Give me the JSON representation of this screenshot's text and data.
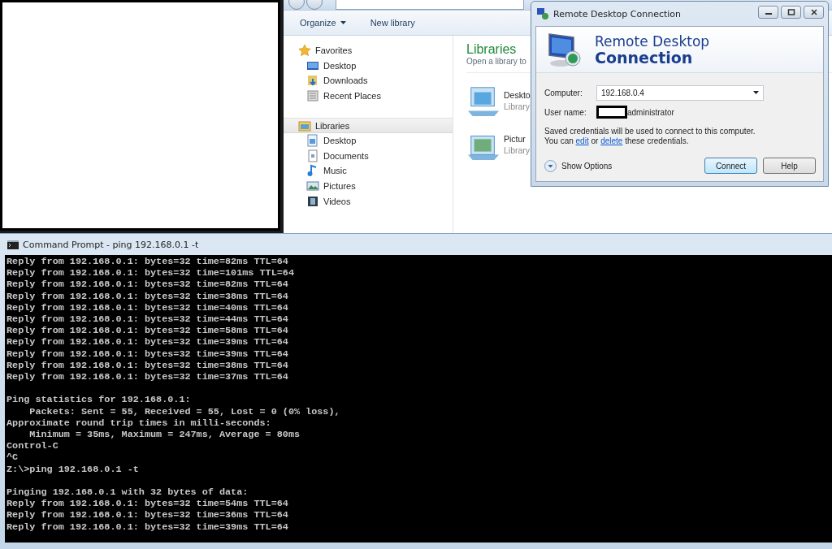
{
  "explorer": {
    "toolbar": [
      {
        "label": "Organize",
        "dropdown": true
      },
      {
        "label": "New library",
        "dropdown": false
      }
    ],
    "nav": [
      {
        "label": "Favorites",
        "selected": false,
        "children": [
          {
            "label": "Desktop"
          },
          {
            "label": "Downloads"
          },
          {
            "label": "Recent Places"
          }
        ]
      },
      {
        "label": "Libraries",
        "selected": true,
        "children": [
          {
            "label": "Desktop"
          },
          {
            "label": "Documents"
          },
          {
            "label": "Music"
          },
          {
            "label": "Pictures"
          },
          {
            "label": "Videos"
          }
        ]
      }
    ],
    "heading": "Libraries",
    "subheading": "Open a library to",
    "items": [
      {
        "name": "Deskto",
        "type": "Library"
      },
      {
        "name": "Pictur",
        "type": "Library"
      }
    ]
  },
  "rdp": {
    "title": "Remote Desktop Connection",
    "banner_top": "Remote Desktop",
    "banner_bottom": "Connection",
    "computer_label": "Computer:",
    "computer_value": "192.168.0.4",
    "username_label": "User name:",
    "username_value": "administrator",
    "note": "Saved credentials will be used to connect to this computer.",
    "note2": [
      {
        "kind": "text",
        "text": "You can "
      },
      {
        "kind": "link",
        "text": "edit"
      },
      {
        "kind": "text",
        "text": " or "
      },
      {
        "kind": "link",
        "text": "delete"
      },
      {
        "kind": "text",
        "text": " these credentials."
      }
    ],
    "options": "Show Options",
    "buttons": [
      {
        "label": "Connect",
        "default": true
      },
      {
        "label": "Help",
        "default": false
      }
    ]
  },
  "cmd": {
    "title": "Command Prompt - ping  192.168.0.1 -t",
    "blocks": [
      [
        "Reply from 192.168.0.1: bytes=32 time=82ms TTL=64",
        "Reply from 192.168.0.1: bytes=32 time=101ms TTL=64",
        "Reply from 192.168.0.1: bytes=32 time=82ms TTL=64",
        "Reply from 192.168.0.1: bytes=32 time=38ms TTL=64",
        "Reply from 192.168.0.1: bytes=32 time=40ms TTL=64",
        "Reply from 192.168.0.1: bytes=32 time=44ms TTL=64",
        "Reply from 192.168.0.1: bytes=32 time=58ms TTL=64",
        "Reply from 192.168.0.1: bytes=32 time=39ms TTL=64",
        "Reply from 192.168.0.1: bytes=32 time=39ms TTL=64",
        "Reply from 192.168.0.1: bytes=32 time=38ms TTL=64",
        "Reply from 192.168.0.1: bytes=32 time=37ms TTL=64"
      ],
      [
        "Ping statistics for 192.168.0.1:",
        "    Packets: Sent = 55, Received = 55, Lost = 0 (0% loss),",
        "Approximate round trip times in milli-seconds:",
        "    Minimum = 35ms, Maximum = 247ms, Average = 80ms",
        "Control-C",
        "^C",
        "Z:\\>ping 192.168.0.1 -t"
      ],
      [
        "Pinging 192.168.0.1 with 32 bytes of data:",
        "Reply from 192.168.0.1: bytes=32 time=54ms TTL=64",
        "Reply from 192.168.0.1: bytes=32 time=36ms TTL=64",
        "Reply from 192.168.0.1: bytes=32 time=39ms TTL=64"
      ]
    ]
  }
}
